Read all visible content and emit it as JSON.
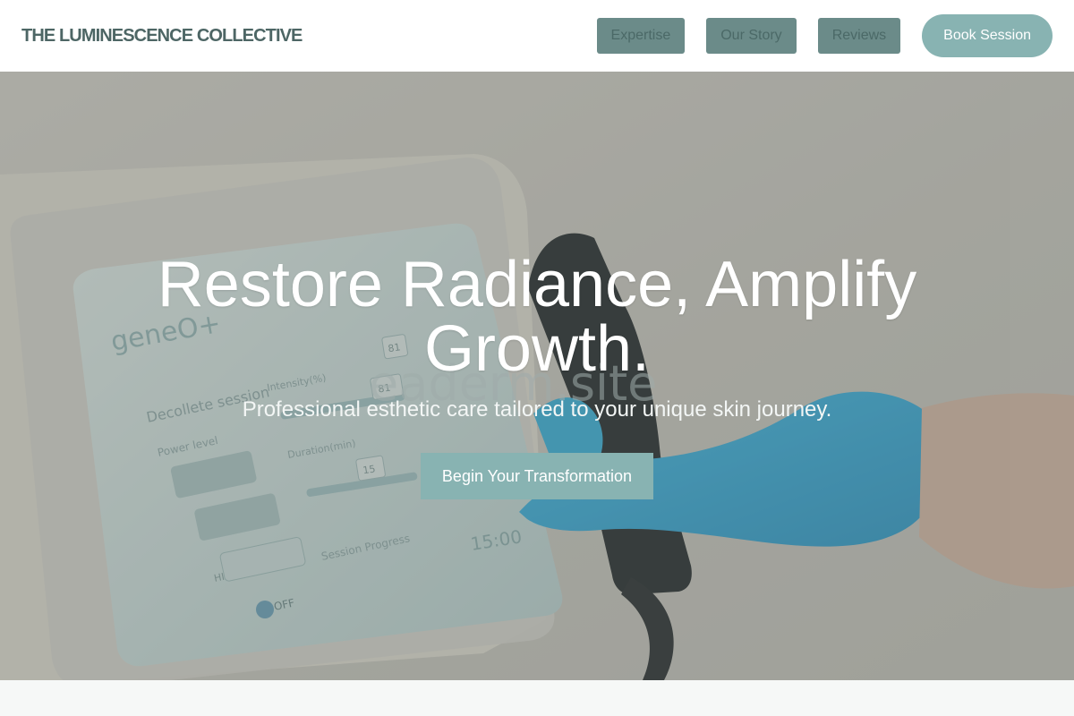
{
  "brand": {
    "name": "THE LUMINESCENCE COLLECTIVE"
  },
  "nav": {
    "links": [
      "Expertise",
      "Our Story",
      "Reviews"
    ],
    "cta_label": "Book Session"
  },
  "hero": {
    "title": "Restore Radiance, Amplify Growth.",
    "subtitle": "Professional esthetic care tailored to your unique skin journey.",
    "cta_label": "Begin Your Transformation",
    "device_screen": {
      "brand": "geneO+",
      "session_title": "Decollete session",
      "power_label": "Power level",
      "intensity_label": "Intensity(%)",
      "duration_label": "Duration(min)",
      "progress_label": "Session Progress",
      "mode_label": "HIGH",
      "toggle_label": "OFF",
      "timer": "15:00",
      "slider_values": [
        "81",
        "81",
        "15"
      ]
    },
    "watermark": "eaderm.site"
  },
  "colors": {
    "brand_text": "#4d6665",
    "nav_button": "#6b8b89",
    "accent": "#88b3b2",
    "header_bg": "#ffffff",
    "bottom_band": "#f6f8f7"
  }
}
